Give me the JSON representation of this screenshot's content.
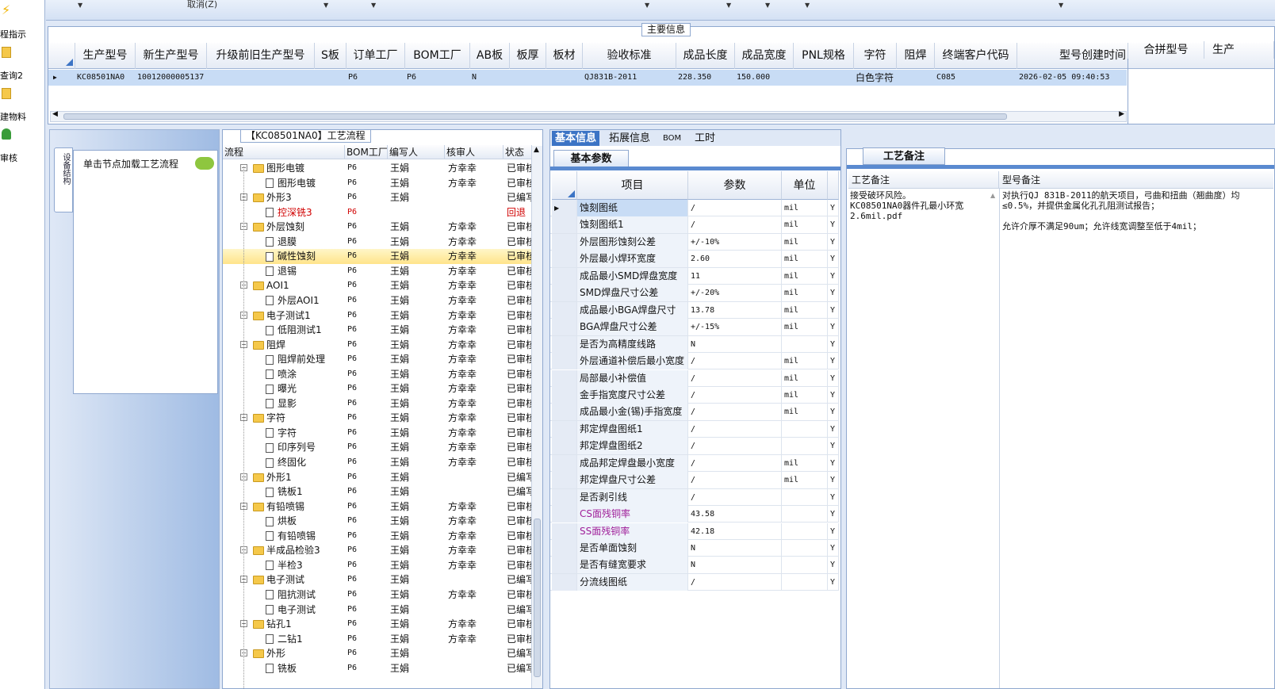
{
  "sidebar": {
    "items": [
      {
        "label": "程指示",
        "icon": "lightning-icon"
      },
      {
        "label": "查询2",
        "icon": "folder-icon"
      },
      {
        "label": "建物料",
        "icon": "folder-icon"
      },
      {
        "label": "审核",
        "icon": "user-icon"
      }
    ]
  },
  "toolbar": {
    "cancel_label": "取消(Z)"
  },
  "main_info": {
    "section_title": "主要信息",
    "columns": [
      "生产型号",
      "新生产型号",
      "升级前旧生产型号",
      "S板",
      "订单工厂",
      "BOM工厂",
      "AB板",
      "板厚",
      "板材",
      "验收标准",
      "成品长度",
      "成品宽度",
      "PNL规格",
      "字符",
      "阻焊",
      "终端客户代码",
      "型号创建时间",
      "合拼型号",
      "生产"
    ],
    "row": {
      "model": "KC08501NA0",
      "new_model": "10012000005137",
      "old_model": "",
      "s_board": "",
      "order_factory": "P6",
      "bom_factory": "P6",
      "ab_board": "N",
      "thickness": "",
      "material": "",
      "standard": "QJ831B-2011",
      "length": "228.350",
      "width": "150.000",
      "pnl": "",
      "char": "白色字符",
      "mask": "",
      "customer_code": "C085",
      "created": "2026-02-05 09:40:53"
    }
  },
  "left": {
    "vtab_label": "设备结构",
    "hint": "单击节点加载工艺流程"
  },
  "flow": {
    "title": "【KC08501NA0】工艺流程",
    "columns": [
      "流程",
      "BOM工厂",
      "编写人",
      "核审人",
      "状态"
    ],
    "rows": [
      {
        "level": 0,
        "exp": "−",
        "name": "图形电镀",
        "bom": "P6",
        "writer": "王娟",
        "reviewer": "方幸幸",
        "status": "已审核"
      },
      {
        "level": 1,
        "name": "图形电镀",
        "bom": "P6",
        "writer": "王娟",
        "reviewer": "方幸幸",
        "status": "已审核"
      },
      {
        "level": 0,
        "exp": "−",
        "name": "外形3",
        "bom": "P6",
        "writer": "王娟",
        "reviewer": "",
        "status": "已编写"
      },
      {
        "level": 1,
        "name": "控深铣3",
        "bom": "P6",
        "writer": "",
        "reviewer": "",
        "status": "回退",
        "red": true
      },
      {
        "level": 0,
        "exp": "−",
        "name": "外层蚀刻",
        "bom": "P6",
        "writer": "王娟",
        "reviewer": "方幸幸",
        "status": "已审核"
      },
      {
        "level": 1,
        "name": "退膜",
        "bom": "P6",
        "writer": "王娟",
        "reviewer": "方幸幸",
        "status": "已审核"
      },
      {
        "level": 1,
        "name": "碱性蚀刻",
        "bom": "P6",
        "writer": "王娟",
        "reviewer": "方幸幸",
        "status": "已审核",
        "selected": true
      },
      {
        "level": 1,
        "name": "退锡",
        "bom": "P6",
        "writer": "王娟",
        "reviewer": "方幸幸",
        "status": "已审核"
      },
      {
        "level": 0,
        "exp": "−",
        "name": "AOI1",
        "bom": "P6",
        "writer": "王娟",
        "reviewer": "方幸幸",
        "status": "已审核"
      },
      {
        "level": 1,
        "name": "外层AOI1",
        "bom": "P6",
        "writer": "王娟",
        "reviewer": "方幸幸",
        "status": "已审核"
      },
      {
        "level": 0,
        "exp": "−",
        "name": "电子测试1",
        "bom": "P6",
        "writer": "王娟",
        "reviewer": "方幸幸",
        "status": "已审核"
      },
      {
        "level": 1,
        "name": "低阻测试1",
        "bom": "P6",
        "writer": "王娟",
        "reviewer": "方幸幸",
        "status": "已审核"
      },
      {
        "level": 0,
        "exp": "−",
        "name": "阻焊",
        "bom": "P6",
        "writer": "王娟",
        "reviewer": "方幸幸",
        "status": "已审核"
      },
      {
        "level": 1,
        "name": "阻焊前处理",
        "bom": "P6",
        "writer": "王娟",
        "reviewer": "方幸幸",
        "status": "已审核"
      },
      {
        "level": 1,
        "name": "喷涂",
        "bom": "P6",
        "writer": "王娟",
        "reviewer": "方幸幸",
        "status": "已审核"
      },
      {
        "level": 1,
        "name": "曝光",
        "bom": "P6",
        "writer": "王娟",
        "reviewer": "方幸幸",
        "status": "已审核"
      },
      {
        "level": 1,
        "name": "显影",
        "bom": "P6",
        "writer": "王娟",
        "reviewer": "方幸幸",
        "status": "已审核"
      },
      {
        "level": 0,
        "exp": "−",
        "name": "字符",
        "bom": "P6",
        "writer": "王娟",
        "reviewer": "方幸幸",
        "status": "已审核"
      },
      {
        "level": 1,
        "name": "字符",
        "bom": "P6",
        "writer": "王娟",
        "reviewer": "方幸幸",
        "status": "已审核"
      },
      {
        "level": 1,
        "name": "印序列号",
        "bom": "P6",
        "writer": "王娟",
        "reviewer": "方幸幸",
        "status": "已审核"
      },
      {
        "level": 1,
        "name": "终固化",
        "bom": "P6",
        "writer": "王娟",
        "reviewer": "方幸幸",
        "status": "已审核"
      },
      {
        "level": 0,
        "exp": "−",
        "name": "外形1",
        "bom": "P6",
        "writer": "王娟",
        "reviewer": "",
        "status": "已编写"
      },
      {
        "level": 1,
        "name": "铣板1",
        "bom": "P6",
        "writer": "王娟",
        "reviewer": "",
        "status": "已编写"
      },
      {
        "level": 0,
        "exp": "−",
        "name": "有铅喷锡",
        "bom": "P6",
        "writer": "王娟",
        "reviewer": "方幸幸",
        "status": "已审核"
      },
      {
        "level": 1,
        "name": "烘板",
        "bom": "P6",
        "writer": "王娟",
        "reviewer": "方幸幸",
        "status": "已审核"
      },
      {
        "level": 1,
        "name": "有铅喷锡",
        "bom": "P6",
        "writer": "王娟",
        "reviewer": "方幸幸",
        "status": "已审核"
      },
      {
        "level": 0,
        "exp": "−",
        "name": "半成品检验3",
        "bom": "P6",
        "writer": "王娟",
        "reviewer": "方幸幸",
        "status": "已审核"
      },
      {
        "level": 1,
        "name": "半检3",
        "bom": "P6",
        "writer": "王娟",
        "reviewer": "方幸幸",
        "status": "已审核"
      },
      {
        "level": 0,
        "exp": "−",
        "name": "电子测试",
        "bom": "P6",
        "writer": "王娟",
        "reviewer": "",
        "status": "已编写"
      },
      {
        "level": 1,
        "name": "阻抗测试",
        "bom": "P6",
        "writer": "王娟",
        "reviewer": "方幸幸",
        "status": "已审核"
      },
      {
        "level": 1,
        "name": "电子测试",
        "bom": "P6",
        "writer": "王娟",
        "reviewer": "",
        "status": "已编写"
      },
      {
        "level": 0,
        "exp": "−",
        "name": "钻孔1",
        "bom": "P6",
        "writer": "王娟",
        "reviewer": "方幸幸",
        "status": "已审核"
      },
      {
        "level": 1,
        "name": "二钻1",
        "bom": "P6",
        "writer": "王娟",
        "reviewer": "方幸幸",
        "status": "已审核"
      },
      {
        "level": 0,
        "exp": "−",
        "name": "外形",
        "bom": "P6",
        "writer": "王娟",
        "reviewer": "",
        "status": "已编写"
      },
      {
        "level": 1,
        "name": "铣板",
        "bom": "P6",
        "writer": "王娟",
        "reviewer": "",
        "status": "已编写"
      }
    ]
  },
  "params": {
    "tabs": [
      "基本信息",
      "拓展信息",
      "BOM",
      "工时"
    ],
    "subtab": "基本参数",
    "columns": [
      "项目",
      "参数",
      "单位"
    ],
    "rows": [
      {
        "item": "蚀刻图纸",
        "value": "/",
        "unit": "mil",
        "flag": "Y",
        "current": true
      },
      {
        "item": "蚀刻图纸1",
        "value": "/",
        "unit": "mil",
        "flag": "Y"
      },
      {
        "item": "外层图形蚀刻公差",
        "value": "+/-10%",
        "unit": "mil",
        "flag": "Y"
      },
      {
        "item": "外层最小焊环宽度",
        "value": "2.60",
        "unit": "mil",
        "flag": "Y"
      },
      {
        "item": "成品最小SMD焊盘宽度",
        "value": "11",
        "unit": "mil",
        "flag": "Y"
      },
      {
        "item": "SMD焊盘尺寸公差",
        "value": "+/-20%",
        "unit": "mil",
        "flag": "Y"
      },
      {
        "item": "成品最小BGA焊盘尺寸",
        "value": "13.78",
        "unit": "mil",
        "flag": "Y"
      },
      {
        "item": "BGA焊盘尺寸公差",
        "value": "+/-15%",
        "unit": "mil",
        "flag": "Y"
      },
      {
        "item": "是否为高精度线路",
        "value": "N",
        "unit": "",
        "flag": "Y"
      },
      {
        "item": "外层通道补偿后最小宽度",
        "value": "/",
        "unit": "mil",
        "flag": "Y"
      },
      {
        "item": "局部最小补偿值",
        "value": "/",
        "unit": "mil",
        "flag": "Y"
      },
      {
        "item": "金手指宽度尺寸公差",
        "value": "/",
        "unit": "mil",
        "flag": "Y"
      },
      {
        "item": "成品最小金(锡)手指宽度",
        "value": "/",
        "unit": "mil",
        "flag": "Y"
      },
      {
        "item": "邦定焊盘图纸1",
        "value": "/",
        "unit": "",
        "flag": "Y"
      },
      {
        "item": "邦定焊盘图纸2",
        "value": "/",
        "unit": "",
        "flag": "Y"
      },
      {
        "item": "成品邦定焊盘最小宽度",
        "value": "/",
        "unit": "mil",
        "flag": "Y"
      },
      {
        "item": "邦定焊盘尺寸公差",
        "value": "/",
        "unit": "mil",
        "flag": "Y"
      },
      {
        "item": "是否剥引线",
        "value": "/",
        "unit": "",
        "flag": "Y"
      },
      {
        "item": "CS面残铜率",
        "value": "43.58",
        "unit": "",
        "flag": "Y",
        "purple": true
      },
      {
        "item": "SS面残铜率",
        "value": "42.18",
        "unit": "",
        "flag": "Y",
        "purple": true
      },
      {
        "item": "是否单面蚀刻",
        "value": "N",
        "unit": "",
        "flag": "Y"
      },
      {
        "item": "是否有缝宽要求",
        "value": "N",
        "unit": "",
        "flag": "Y"
      },
      {
        "item": "分流线图纸",
        "value": "/",
        "unit": "",
        "flag": "Y"
      }
    ]
  },
  "notes": {
    "tab": "工艺备注",
    "process_header": "工艺备注",
    "model_header": "型号备注",
    "process_note": "接受破环风险。\nKC08501NA0器件孔最小环宽\n2.6mil.pdf",
    "model_note": "对执行QJ 831B-2011的航天项目，弓曲和扭曲（翘曲度）均\n≤0.5%，并提供金属化孔孔阻测试报告；\n\n允许介厚不满足90um；允许线宽调整至低于4mil；"
  },
  "colors": {
    "accent": "#3c74c5",
    "select": "#c8dcf5",
    "highlight": "#ffe48a",
    "red": "#d00000",
    "purple": "#a0209a"
  }
}
